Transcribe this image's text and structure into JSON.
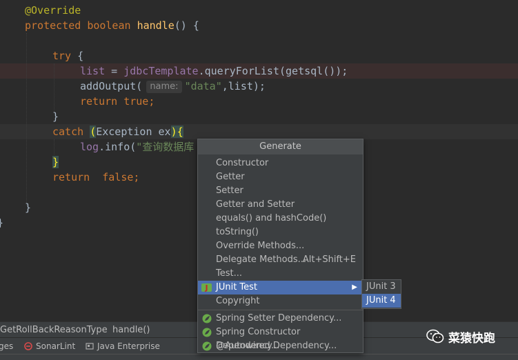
{
  "editor": {
    "lines": {
      "override": "@Override",
      "l2_protected": "protected",
      "l2_boolean": "boolean",
      "l2_method": "handle",
      "l2_rest": "() {",
      "l4_try": "try",
      "l4_rest": " {",
      "l5_list": "list",
      "l5_eq": " = ",
      "l5_field": "jdbcTemplate",
      "l5_call": ".queryForList(getsql());",
      "l6_call": "addOutput(",
      "l6_hint": "name:",
      "l6_str": "\"data\"",
      "l6_rest": ",list);",
      "l7_return": "return",
      "l7_true": " true;",
      "l8": "}",
      "l9_catch": "catch",
      "l9_sp": " ",
      "l9_open": "(",
      "l9_mid": "Exception ex",
      "l9_close": "){",
      "l10_log": "log",
      "l10_info": ".info(",
      "l10_str": "\"查询数据库",
      "l11": "}",
      "l12_return": "return",
      "l12_false": "  false;",
      "l14": "}",
      "l15": "}"
    }
  },
  "popup": {
    "title": "Generate",
    "items": [
      {
        "label": "Constructor"
      },
      {
        "label": "Getter"
      },
      {
        "label": "Setter"
      },
      {
        "label": "Getter and Setter"
      },
      {
        "label": "equals() and hashCode()"
      },
      {
        "label": "toString()"
      },
      {
        "label": "Override Methods..."
      },
      {
        "label": "Delegate Methods...",
        "shortcut": "Alt+Shift+E"
      },
      {
        "label": "Test..."
      },
      {
        "label": "JUnit Test",
        "icon": "junit-icon"
      },
      {
        "label": "Copyright"
      },
      {
        "label": "Spring Setter Dependency...",
        "icon": "spring-leaf-icon"
      },
      {
        "label": "Spring Constructor Dependency...",
        "icon": "spring-leaf-icon"
      },
      {
        "label": "@Autowired Dependency...",
        "icon": "spring-leaf-icon"
      }
    ]
  },
  "submenu": {
    "items": [
      "JUnit 3",
      "JUnit 4"
    ],
    "selected": "JUnit 4"
  },
  "breadcrumb": {
    "class": "GetRollBackReasonType",
    "separator": "›",
    "method": "handle()"
  },
  "toolstrip": {
    "partial": "ges",
    "sonarlint": "SonarLint",
    "java_enterprise": "Java Enterprise"
  },
  "watermark": {
    "text": "菜猿快跑"
  },
  "colors": {
    "keyword": "#cc7832",
    "annotation": "#bbb529",
    "method": "#ffc66d",
    "field": "#9876aa",
    "string": "#6a8759",
    "selection": "#4b6eaf",
    "spring": "#6aab4a"
  }
}
